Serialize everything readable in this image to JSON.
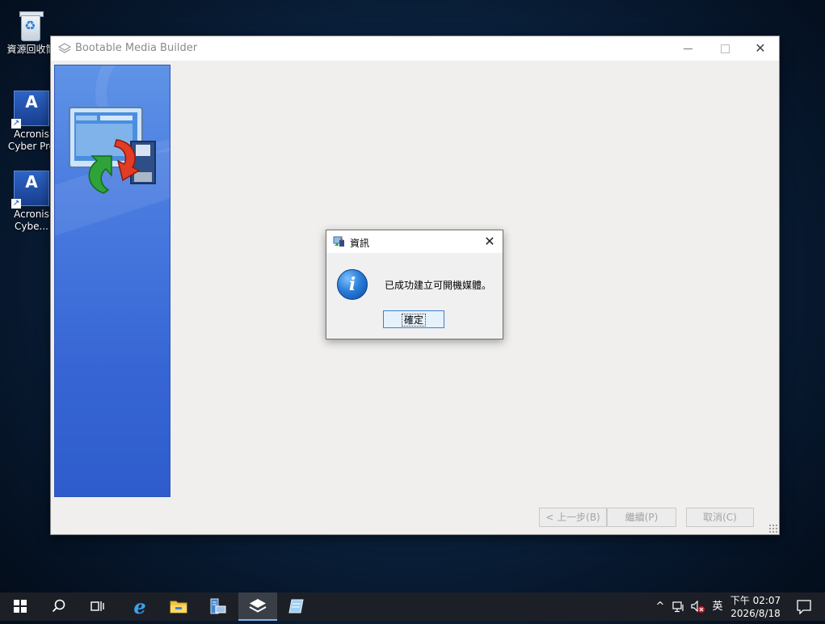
{
  "desktop": {
    "icons": [
      {
        "label": "資源回收筒",
        "icon": "recycle-bin-icon"
      },
      {
        "label": "Acronis Cyber Pro",
        "icon": "acronis-icon"
      },
      {
        "label": "Acronis Cybe...",
        "icon": "acronis-icon"
      }
    ]
  },
  "window": {
    "title": "Bootable Media Builder",
    "buttons": {
      "back": "< 上一步(B)",
      "next": "繼續(P)",
      "cancel": "取消(C)"
    }
  },
  "dialog": {
    "title": "資訊",
    "message": "已成功建立可開機媒體。",
    "ok": "確定",
    "icon": "info-icon"
  },
  "taskbar": {
    "items": [
      "start-icon",
      "search-icon",
      "task-view-icon",
      "internet-explorer-icon",
      "file-explorer-icon",
      "server-manager-icon",
      "bootable-media-builder-icon",
      "notepad-icon"
    ],
    "tray": {
      "chevron": "^",
      "ime": "英",
      "time": "下午 02:07",
      "date": "2026/8/18"
    }
  },
  "colors": {
    "accent": "#3c7fd3",
    "side_panel": "#3766d4",
    "taskbar": "#1c2026"
  }
}
